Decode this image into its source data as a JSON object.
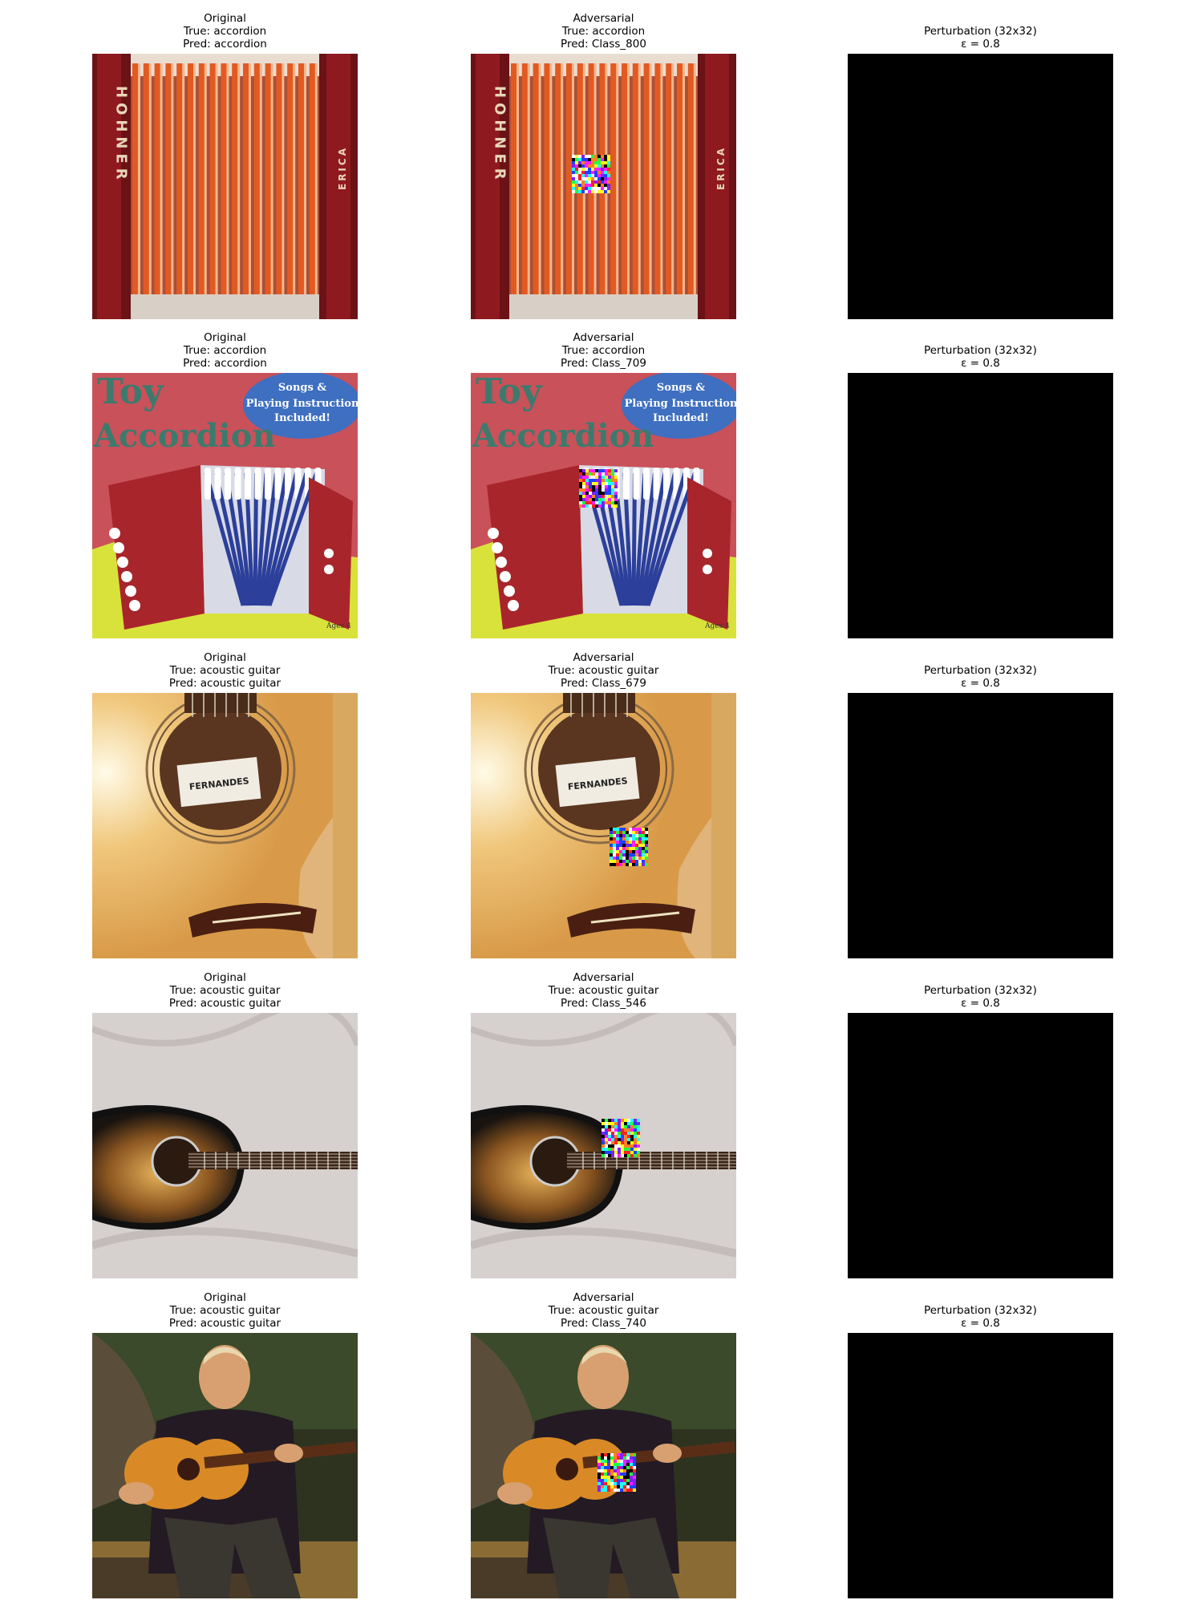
{
  "rows": [
    {
      "image": "accordion-closeup",
      "original": {
        "lines": [
          "Original",
          "True: accordion",
          "Pred: accordion"
        ]
      },
      "adversarial": {
        "lines": [
          "Adversarial",
          "True: accordion",
          "Pred: Class_800"
        ]
      },
      "perturbation": {
        "lines": [
          "Perturbation (32x32)",
          "ε = 0.8"
        ]
      }
    },
    {
      "image": "toy-accordion-box",
      "original": {
        "lines": [
          "Original",
          "True: accordion",
          "Pred: accordion"
        ]
      },
      "adversarial": {
        "lines": [
          "Adversarial",
          "True: accordion",
          "Pred: Class_709"
        ]
      },
      "perturbation": {
        "lines": [
          "Perturbation (32x32)",
          "ε = 0.8"
        ]
      }
    },
    {
      "image": "guitar-soundhole",
      "original": {
        "lines": [
          "Original",
          "True: acoustic guitar",
          "Pred: acoustic guitar"
        ]
      },
      "adversarial": {
        "lines": [
          "Adversarial",
          "True: acoustic guitar",
          "Pred: Class_679"
        ]
      },
      "perturbation": {
        "lines": [
          "Perturbation (32x32)",
          "ε = 0.8"
        ]
      }
    },
    {
      "image": "sunburst-guitar-on-cloth",
      "original": {
        "lines": [
          "Original",
          "True: acoustic guitar",
          "Pred: acoustic guitar"
        ]
      },
      "adversarial": {
        "lines": [
          "Adversarial",
          "True: acoustic guitar",
          "Pred: Class_546"
        ]
      },
      "perturbation": {
        "lines": [
          "Perturbation (32x32)",
          "ε = 0.8"
        ]
      }
    },
    {
      "image": "man-playing-guitar",
      "original": {
        "lines": [
          "Original",
          "True: acoustic guitar",
          "Pred: acoustic guitar"
        ]
      },
      "adversarial": {
        "lines": [
          "Adversarial",
          "True: acoustic guitar",
          "Pred: Class_740"
        ]
      },
      "perturbation": {
        "lines": [
          "Perturbation (32x32)",
          "ε = 0.8"
        ]
      }
    }
  ],
  "image_text": {
    "hohner": "HOHNER",
    "erica": "ERICA",
    "songs_badge": [
      "Songs &",
      "Playing Instruction",
      "Included!"
    ],
    "toy": "Toy",
    "accordion": "Accordion",
    "ages": "Ages 4",
    "fernandes": "FERNANDES"
  },
  "colors": {
    "perturbation_fill": "#000000",
    "title_text": "#000000"
  }
}
